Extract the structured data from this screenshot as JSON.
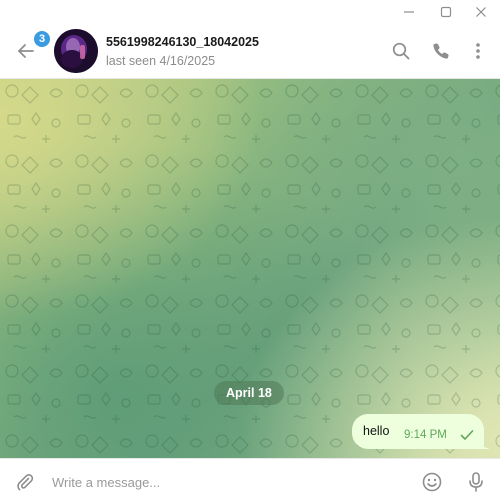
{
  "window": {
    "controls": [
      "minimize-icon",
      "maximize-icon",
      "close-icon"
    ]
  },
  "header": {
    "unread_badge": "3",
    "peer_name": "5561998246130_18042025",
    "peer_status": "last seen 4/16/2025",
    "icons": [
      "back-arrow-icon",
      "search-icon",
      "phone-icon",
      "more-vertical-icon"
    ]
  },
  "chat": {
    "date_separator": "April 18",
    "messages": [
      {
        "text": "hello",
        "time": "9:14 PM",
        "outgoing": true,
        "status": "sent-check-icon"
      }
    ]
  },
  "composer": {
    "placeholder": "Write a message...",
    "value": "",
    "icons": [
      "paperclip-icon",
      "emoji-icon",
      "microphone-icon"
    ]
  },
  "colors": {
    "accent": "#3a9be0",
    "outgoing_bubble": "#eeffde",
    "time_green": "#5fa75a",
    "icon_gray": "#8e8e8e"
  }
}
